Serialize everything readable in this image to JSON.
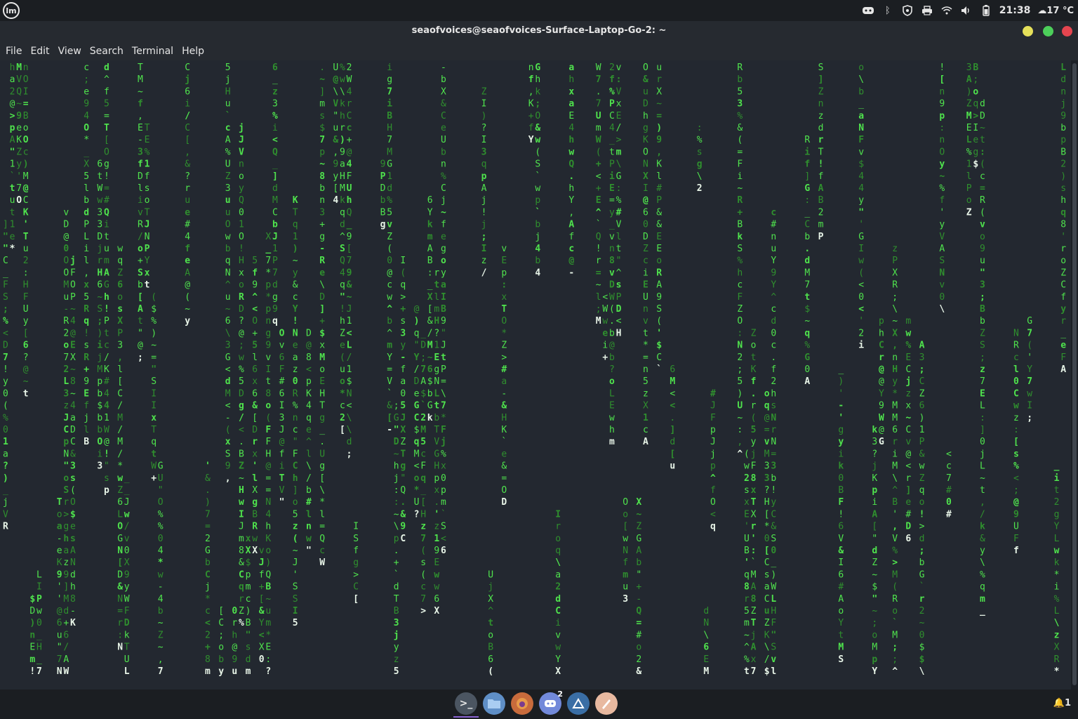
{
  "panel": {
    "clock": "21:38",
    "weather": "17 °C",
    "notifications_count": "1",
    "icons": [
      "menu-logo-icon",
      "discord-tray-icon",
      "bluetooth-icon",
      "shield-icon",
      "printer-icon",
      "wifi-icon",
      "volume-icon",
      "battery-icon",
      "weather-cloud-icon"
    ]
  },
  "window": {
    "title": "seaofvoices@seaofvoices-Surface-Laptop-Go-2: ~",
    "button_colors": {
      "minimize": "#e5e05a",
      "maximize": "#4ccf5a",
      "close": "#e5454f"
    }
  },
  "menu": [
    "File",
    "Edit",
    "View",
    "Search",
    "Terminal",
    "Help"
  ],
  "colors": {
    "matrix_green": "#4fe34d",
    "matrix_dim": "#2f8f2e",
    "matrix_bright": "#e8f5e8"
  },
  "taskbar": {
    "apps": [
      {
        "name": "terminal",
        "glyph": ">_",
        "active": true
      },
      {
        "name": "files",
        "glyph": "",
        "active": false
      },
      {
        "name": "firefox",
        "glyph": "",
        "active": false
      },
      {
        "name": "discord",
        "glyph": "",
        "active": false
      },
      {
        "name": "steam",
        "glyph": "",
        "active": false
      },
      {
        "name": "text-editor",
        "glyph": "",
        "active": false
      }
    ],
    "discord_badge": "2"
  }
}
